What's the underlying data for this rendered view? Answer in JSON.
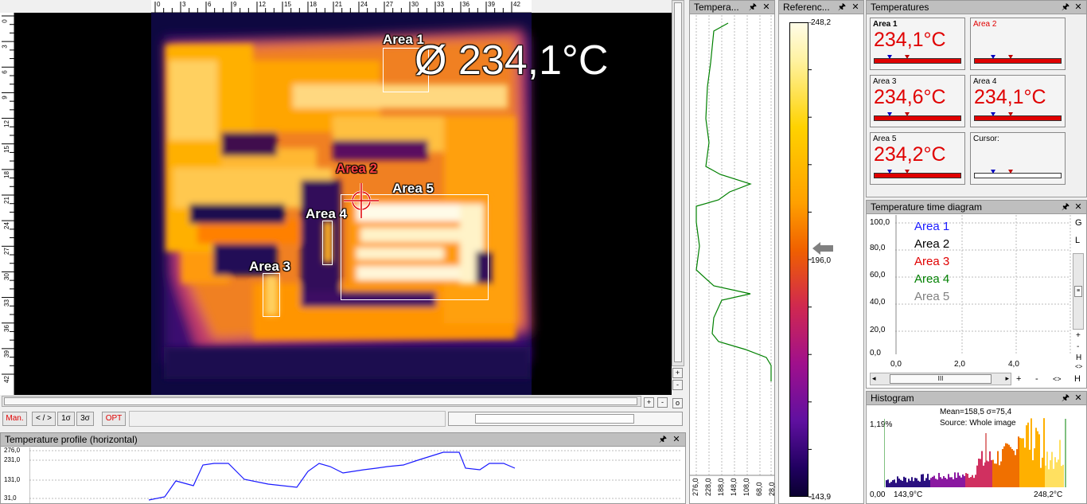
{
  "thermal": {
    "x_ticks": [
      "0",
      "3",
      "6",
      "9",
      "12",
      "15",
      "18",
      "21",
      "24",
      "27",
      "30",
      "33",
      "36",
      "39",
      "42"
    ],
    "y_ticks": [
      "0",
      "3",
      "6",
      "9",
      "12",
      "15",
      "18",
      "21",
      "24",
      "27",
      "30",
      "33",
      "36",
      "39",
      "42"
    ],
    "overlay_value": "Ø 234,1°C",
    "areas": {
      "a1": "Area 1",
      "a2": "Area 2",
      "a3": "Area 3",
      "a4": "Area 4",
      "a5": "Area 5"
    }
  },
  "toolbar": {
    "man": "Man.",
    "swap": "< / >",
    "sigma1": "1σ",
    "sigma3": "3σ",
    "opt": "OPT",
    "zoom_in": "+",
    "zoom_out": "-",
    "zoom_reset": "o"
  },
  "profile_h": {
    "title": "Temperature profile (horizontal)",
    "y_ticks": [
      "276,0",
      "231,0",
      "131,0",
      "31,0"
    ]
  },
  "profile_v": {
    "title": "Tempera...",
    "x_ticks": [
      "276,0",
      "228,0",
      "188,0",
      "148,0",
      "108,0",
      "68,0",
      "28,0"
    ]
  },
  "reference": {
    "title": "Referenc...",
    "max": "248,2",
    "mid": "196,0",
    "min": "143,9"
  },
  "temperatures": {
    "title": "Temperatures",
    "cells": [
      {
        "name": "Area 1",
        "value": "234,1°C"
      },
      {
        "name": "Area 2",
        "value": ""
      },
      {
        "name": "Area 3",
        "value": "234,6°C"
      },
      {
        "name": "Area 4",
        "value": "234,1°C"
      },
      {
        "name": "Area 5",
        "value": "234,2°C"
      },
      {
        "name": "Cursor:",
        "value": ""
      }
    ]
  },
  "time_diagram": {
    "title": "Temperature time diagram",
    "y_ticks": [
      "100,0",
      "80,0",
      "60,0",
      "40,0",
      "20,0",
      "0,0"
    ],
    "x_ticks": [
      "0,0",
      "2,0",
      "4,0"
    ],
    "legend": [
      {
        "label": "Area 1",
        "color": "#1a1aff"
      },
      {
        "label": "Area 2",
        "color": "#000000"
      },
      {
        "label": "Area 3",
        "color": "#e00000"
      },
      {
        "label": "Area 4",
        "color": "#008000"
      },
      {
        "label": "Area 5",
        "color": "#808080"
      }
    ],
    "side": {
      "g": "G",
      "l": "L",
      "plus": "+",
      "minus": "-",
      "h": "H",
      "lr": "<>"
    },
    "scroll_thumb": "III",
    "bottom": {
      "plus": "+",
      "minus": "-",
      "lr": "<>",
      "h": "H"
    }
  },
  "histogram": {
    "title": "Histogram",
    "stats": "Mean=158,5 σ=75,4",
    "source": "Source:  Whole image",
    "pct": "1,19%",
    "x_left": "0,00",
    "x_min": "143,9°C",
    "x_max": "248,2°C"
  },
  "panel_icons": {
    "pin": "🖈",
    "close": "✕"
  }
}
